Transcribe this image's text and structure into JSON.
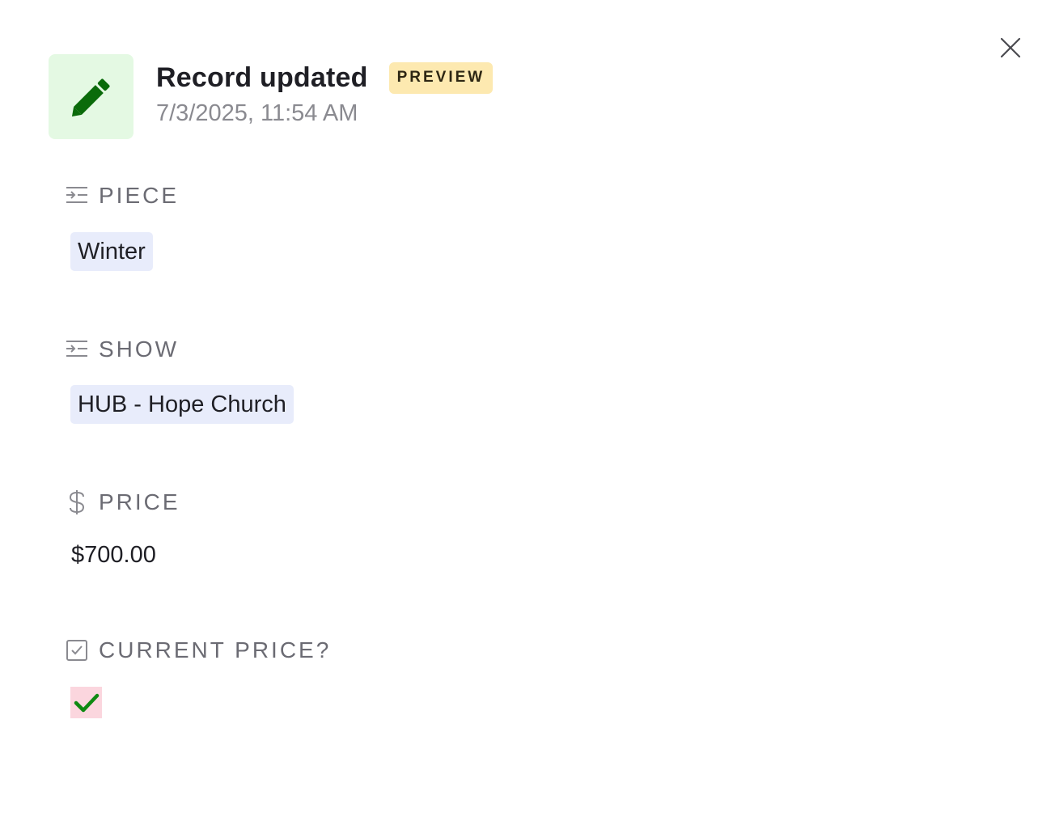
{
  "header": {
    "title": "Record updated",
    "badge": "PREVIEW",
    "timestamp": "7/3/2025, 11:54 AM",
    "icon": "pencil-icon"
  },
  "close_icon": "close-icon",
  "fields": {
    "piece": {
      "label": "PIECE",
      "icon": "link-field-icon",
      "value": "Winter"
    },
    "show": {
      "label": "SHOW",
      "icon": "link-field-icon",
      "value": "HUB - Hope Church"
    },
    "price": {
      "label": "PRICE",
      "icon": "dollar-icon",
      "value": "$700.00"
    },
    "current_price": {
      "label": "CURRENT PRICE?",
      "icon": "checkbox-field-icon",
      "checked": true
    }
  },
  "colors": {
    "header_icon_bg": "#e4f9e3",
    "header_icon_fg": "#0a6b0a",
    "badge_bg": "#fde9b0",
    "chip_bg": "#e8ecfb",
    "checkbox_bg": "#fbd6de",
    "check_color": "#0f8a12"
  }
}
